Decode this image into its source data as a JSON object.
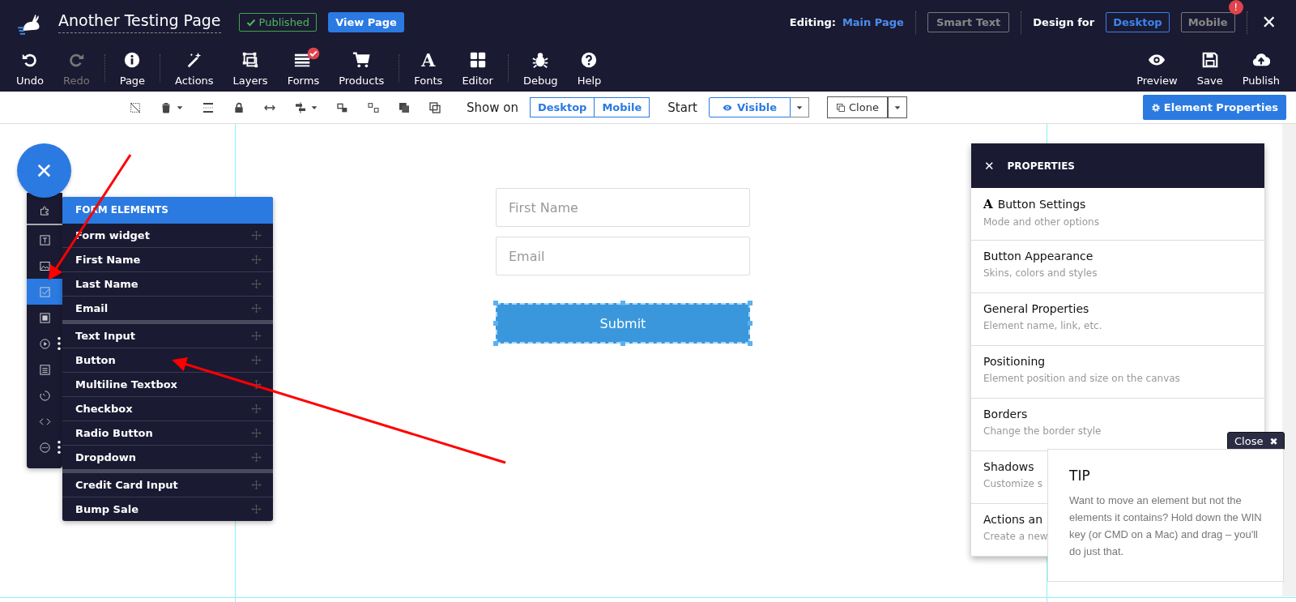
{
  "header": {
    "title": "Another Testing Page",
    "status": "Published",
    "view_button": "View Page",
    "editing_label": "Editing:",
    "editing_page": "Main Page",
    "smart_text": "Smart Text",
    "design_label": "Design for",
    "design_options": [
      {
        "label": "Desktop",
        "selected": true,
        "alert": false
      },
      {
        "label": "Mobile",
        "selected": false,
        "alert": true
      }
    ],
    "alert_mark": "!",
    "close": "✕"
  },
  "toolbar": {
    "left": [
      {
        "label": "Undo",
        "disabled": false,
        "badge": false
      },
      {
        "label": "Redo",
        "disabled": true,
        "badge": false
      },
      {
        "label": "Page",
        "disabled": false,
        "badge": false
      },
      {
        "label": "Actions",
        "disabled": false,
        "badge": false
      },
      {
        "label": "Layers",
        "disabled": false,
        "badge": false
      },
      {
        "label": "Forms",
        "disabled": false,
        "badge": true
      },
      {
        "label": "Products",
        "disabled": false,
        "badge": false
      },
      {
        "label": "Fonts",
        "disabled": false,
        "badge": false,
        "glyph": "A"
      },
      {
        "label": "Editor",
        "disabled": false,
        "badge": false
      },
      {
        "label": "Debug",
        "disabled": false,
        "badge": false
      },
      {
        "label": "Help",
        "disabled": false,
        "badge": false
      }
    ],
    "right": [
      {
        "label": "Preview",
        "disabled": false,
        "badge": false
      },
      {
        "label": "Save",
        "disabled": false,
        "badge": false
      },
      {
        "label": "Publish",
        "disabled": false,
        "badge": false
      }
    ]
  },
  "element_bar": {
    "show_on_label": "Show on",
    "show_on": [
      {
        "label": "Desktop",
        "selected": true
      },
      {
        "label": "Mobile",
        "selected": true
      }
    ],
    "start_label": "Start",
    "visibility": "Visible",
    "clone": "Clone",
    "properties_button": "Element Properties"
  },
  "canvas": {
    "fields": [
      {
        "placeholder": "First Name"
      },
      {
        "placeholder": "Email"
      }
    ],
    "submit": "Submit",
    "submit_selected": true
  },
  "fab": {
    "symbol": "✕"
  },
  "side_strip": [
    {
      "selected": false
    },
    {
      "selected": false
    },
    {
      "selected": false
    },
    {
      "selected": true
    },
    {
      "selected": false
    },
    {
      "selected": false,
      "more": true
    },
    {
      "selected": false
    },
    {
      "selected": false
    },
    {
      "selected": false
    },
    {
      "selected": false,
      "more": true
    }
  ],
  "elements_menu": {
    "title": "FORM ELEMENTS",
    "groups": [
      [
        "Form widget",
        "First Name",
        "Last Name",
        "Email"
      ],
      [
        "Text Input",
        "Button",
        "Multiline Textbox",
        "Checkbox",
        "Radio Button",
        "Dropdown"
      ],
      [
        "Credit Card Input",
        "Bump Sale"
      ]
    ]
  },
  "properties": {
    "title": "PROPERTIES",
    "close": "✕",
    "items": [
      {
        "title": "Button Settings",
        "subtitle": "Mode and other options",
        "glyph": "A"
      },
      {
        "title": "Button Appearance",
        "subtitle": "Skins, colors and styles"
      },
      {
        "title": "General Properties",
        "subtitle": "Element name, link, etc."
      },
      {
        "title": "Positioning",
        "subtitle": "Element position and size on the canvas"
      },
      {
        "title": "Borders",
        "subtitle": "Change the border style"
      },
      {
        "title": "Shadows",
        "subtitle": "Customize s"
      },
      {
        "title": "Actions an",
        "subtitle": "Create a new"
      }
    ]
  },
  "tip": {
    "close": "Close",
    "close_mark": "✖",
    "title": "TIP",
    "text": "Want to move an element but not the elements it contains? Hold down the WIN key (or CMD on a Mac) and drag – you'll do just that."
  }
}
